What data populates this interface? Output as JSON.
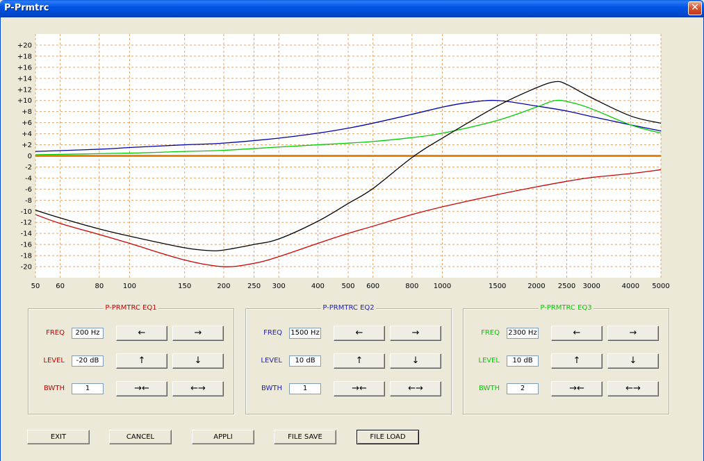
{
  "window": {
    "title": "P-Prmtrc",
    "close_icon": "close-icon"
  },
  "chart_data": {
    "type": "line",
    "x_scale": "log",
    "xlim": [
      50,
      5000
    ],
    "ylim": [
      -22,
      22
    ],
    "x_ticks": [
      50,
      60,
      80,
      100,
      150,
      200,
      250,
      300,
      400,
      500,
      600,
      800,
      1000,
      1500,
      2000,
      2500,
      3000,
      4000,
      5000
    ],
    "y_ticks": [
      20,
      18,
      16,
      14,
      12,
      10,
      8,
      6,
      4,
      2,
      0,
      -2,
      -4,
      -6,
      -8,
      -10,
      -12,
      -14,
      -16,
      -18,
      -20
    ],
    "y_tick_labels": [
      "+20",
      "+18",
      "+16",
      "+14",
      "+12",
      "+10",
      "+8",
      "+6",
      "+4",
      "+2",
      "0",
      "-2",
      "-4",
      "-6",
      "-8",
      "-10",
      "-12",
      "-14",
      "-16",
      "-18",
      "-20"
    ],
    "grid": true,
    "colors": {
      "background": "#FFFFFF",
      "grid": "#F0A050",
      "zero_line": "#F08000"
    },
    "series": [
      {
        "color": "#CC0000",
        "points": [
          [
            50,
            -10.6
          ],
          [
            60,
            -12.2
          ],
          [
            80,
            -14.2
          ],
          [
            100,
            -15.8
          ],
          [
            150,
            -18.8
          ],
          [
            200,
            -20
          ],
          [
            250,
            -19.4
          ],
          [
            300,
            -18.2
          ],
          [
            400,
            -15.8
          ],
          [
            500,
            -14
          ],
          [
            600,
            -12.7
          ],
          [
            800,
            -10.6
          ],
          [
            1000,
            -9.2
          ],
          [
            1500,
            -7
          ],
          [
            2000,
            -5.6
          ],
          [
            2500,
            -4.6
          ],
          [
            3000,
            -3.9
          ],
          [
            4000,
            -3.2
          ],
          [
            5000,
            -2.5
          ]
        ]
      },
      {
        "color": "#0000AA",
        "points": [
          [
            50,
            0.8
          ],
          [
            80,
            1.2
          ],
          [
            100,
            1.5
          ],
          [
            150,
            2.0
          ],
          [
            200,
            2.3
          ],
          [
            300,
            3.2
          ],
          [
            400,
            4.1
          ],
          [
            500,
            5.0
          ],
          [
            600,
            5.9
          ],
          [
            800,
            7.5
          ],
          [
            1000,
            8.8
          ],
          [
            1200,
            9.6
          ],
          [
            1500,
            10
          ],
          [
            2000,
            9.0
          ],
          [
            2500,
            8.1
          ],
          [
            3000,
            7.1
          ],
          [
            4000,
            5.6
          ],
          [
            5000,
            4.5
          ]
        ]
      },
      {
        "color": "#00CC00",
        "points": [
          [
            50,
            0.2
          ],
          [
            100,
            0.5
          ],
          [
            150,
            0.8
          ],
          [
            200,
            1.0
          ],
          [
            300,
            1.6
          ],
          [
            400,
            2.0
          ],
          [
            500,
            2.3
          ],
          [
            600,
            2.6
          ],
          [
            800,
            3.3
          ],
          [
            1000,
            4.1
          ],
          [
            1500,
            6.4
          ],
          [
            2000,
            8.8
          ],
          [
            2300,
            10
          ],
          [
            2600,
            9.6
          ],
          [
            3000,
            8.5
          ],
          [
            4000,
            5.6
          ],
          [
            5000,
            4.1
          ]
        ]
      },
      {
        "color": "#000000",
        "points": [
          [
            50,
            -9.8
          ],
          [
            60,
            -11.2
          ],
          [
            80,
            -13.2
          ],
          [
            100,
            -14.5
          ],
          [
            150,
            -16.6
          ],
          [
            180,
            -17.1
          ],
          [
            200,
            -17.0
          ],
          [
            250,
            -16.0
          ],
          [
            300,
            -15
          ],
          [
            400,
            -11.8
          ],
          [
            500,
            -8.6
          ],
          [
            600,
            -5.9
          ],
          [
            800,
            -0.3
          ],
          [
            1000,
            3.2
          ],
          [
            1500,
            9.0
          ],
          [
            2000,
            12.3
          ],
          [
            2300,
            13.4
          ],
          [
            2500,
            12.9
          ],
          [
            3000,
            10.5
          ],
          [
            4000,
            7.2
          ],
          [
            5000,
            5.9
          ]
        ]
      }
    ]
  },
  "eq_panels": [
    {
      "title": "P-PRMTRC EQ1",
      "color": "#CC0000",
      "freq_label": "FREQ",
      "freq_value": "200 Hz",
      "level_label": "LEVEL",
      "level_value": "-20 dB",
      "bwth_label": "BWTH",
      "bwth_value": "1"
    },
    {
      "title": "P-PRMTRC EQ2",
      "color": "#2020C0",
      "freq_label": "FREQ",
      "freq_value": "1500 Hz",
      "level_label": "LEVEL",
      "level_value": "10 dB",
      "bwth_label": "BWTH",
      "bwth_value": "1"
    },
    {
      "title": "P-PRMTRC EQ3",
      "color": "#00CC00",
      "freq_label": "FREQ",
      "freq_value": "2300 Hz",
      "level_label": "LEVEL",
      "level_value": "10 dB",
      "bwth_label": "BWTH",
      "bwth_value": "2"
    }
  ],
  "arrows": {
    "freq_down": "←",
    "freq_up": "→",
    "level_up": "↑",
    "level_down": "↓",
    "narrow": "→←",
    "widen": "←→"
  },
  "bottom_buttons": {
    "exit": "EXIT",
    "cancel": "CANCEL",
    "appli": "APPLI",
    "file_save": "FILE SAVE",
    "file_load": "FILE LOAD"
  }
}
